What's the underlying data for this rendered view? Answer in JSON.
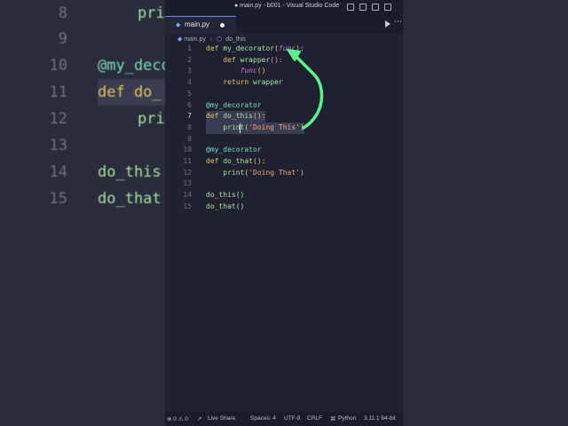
{
  "background": {
    "lines": [
      {
        "num": "8",
        "code": "pri"
      },
      {
        "num": "9",
        "code": ""
      },
      {
        "num": "10",
        "code": "@my_decor"
      },
      {
        "num": "11",
        "code": "def do_"
      },
      {
        "num": "12",
        "code": "pri"
      },
      {
        "num": "13",
        "code": ""
      },
      {
        "num": "14",
        "code": "do_this"
      },
      {
        "num": "15",
        "code": "do_that"
      }
    ]
  },
  "window": {
    "title": "● main.py - b001 - Visual Studio Code",
    "tab_label": "main.py",
    "breadcrumb": {
      "file": "main.py",
      "symbol": "do_this"
    }
  },
  "editor": {
    "line_numbers": [
      "1",
      "2",
      "3",
      "4",
      "5",
      "6",
      "7",
      "8",
      "9",
      "10",
      "11",
      "12",
      "13",
      "14",
      "15"
    ],
    "active_line": "7",
    "lines": {
      "l1": {
        "kw": "def",
        "fn": "my_decorator",
        "open": "(",
        "param": "func",
        "close": "):"
      },
      "l2": {
        "kw": "def",
        "fn": "wrapper",
        "rest": "():"
      },
      "l3": {
        "fn": "func",
        "rest": "()"
      },
      "l4": {
        "kw": "return",
        "rest": "wrapper"
      },
      "l6": {
        "dec": "@my_decorator"
      },
      "l7": {
        "kw": "def",
        "fn": "do_this",
        "rest": "():"
      },
      "l8": {
        "fn": "print",
        "open": "(",
        "str": "'Doing This'",
        "close": ")"
      },
      "l10": {
        "dec": "@my_decorator"
      },
      "l11": {
        "kw": "def",
        "fn": "do_that",
        "rest": "():"
      },
      "l12": {
        "fn": "print",
        "open": "(",
        "str": "'Doing That'",
        "close": ")"
      },
      "l14": {
        "call": "do_this()"
      },
      "l15": {
        "call": "do_that()"
      }
    }
  },
  "statusbar": {
    "problems": "⊗ 0 ⚠ 0",
    "live_share": "Live Share",
    "spaces": "Spaces: 4",
    "encoding": "UTF-8",
    "eol": "CRLF",
    "language": "Python",
    "interpreter": "3.11.1 64-bit"
  },
  "colors": {
    "keyword": "#e2c45f",
    "function": "#a6e3a1",
    "decorator": "#7fdcb6",
    "string": "#f0a47a",
    "param": "#c678dd",
    "arrow": "#5cf08a"
  }
}
